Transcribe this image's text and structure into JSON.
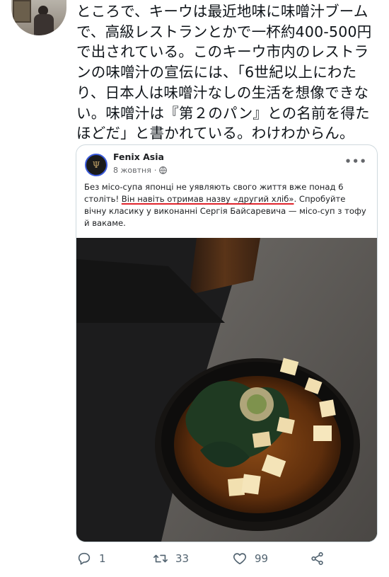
{
  "tweet": {
    "text": "ところで、キーウは最近地味に味噌汁ブーム\nで、高級レストランとかで一杯約400-500円\nで出されている。このキーウ市内のレストラ\nンの味噌汁の宣伝には、「6世紀以上にわた\nり、日本人は味噌汁なしの生活を想像できな\nい。味噌汁は『第２のパン』との名前を得た\nほどだ」と書かれている。わけわからん。"
  },
  "embedded_post": {
    "page_name": "Fenix Asia",
    "date": "8 жовтня",
    "text_before": "Без місо-супа японці не уявляють свого життя вже понад 6 століть! ",
    "text_highlight": "Він навіть отримав назву «другий хліб»",
    "text_after": ". Спробуйте вічну класику у виконанні Сергія Байсаревича — місо-суп з тофу й вакаме.",
    "highlight_color": "#e0242c"
  },
  "actions": {
    "reply_count": "1",
    "retweet_count": "33",
    "like_count": "99"
  },
  "icons": {
    "reply": "reply-icon",
    "retweet": "retweet-icon",
    "like": "heart-icon",
    "share": "share-icon",
    "globe": "globe-icon",
    "more": "more-horizontal-icon"
  }
}
